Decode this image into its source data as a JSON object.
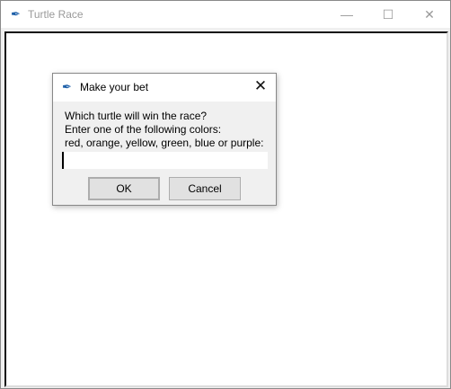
{
  "window": {
    "title": "Turtle Race",
    "minimize": "—",
    "maximize": "☐",
    "close": "✕"
  },
  "dialog": {
    "title": "Make your bet",
    "close": "✕",
    "prompt_lines": [
      "Which turtle will win the race?",
      "Enter one of the following colors:",
      "red, orange, yellow, green, blue or purple:"
    ],
    "input_value": "",
    "ok_label": "OK",
    "cancel_label": "Cancel"
  },
  "icons": {
    "app": "feather-icon"
  }
}
